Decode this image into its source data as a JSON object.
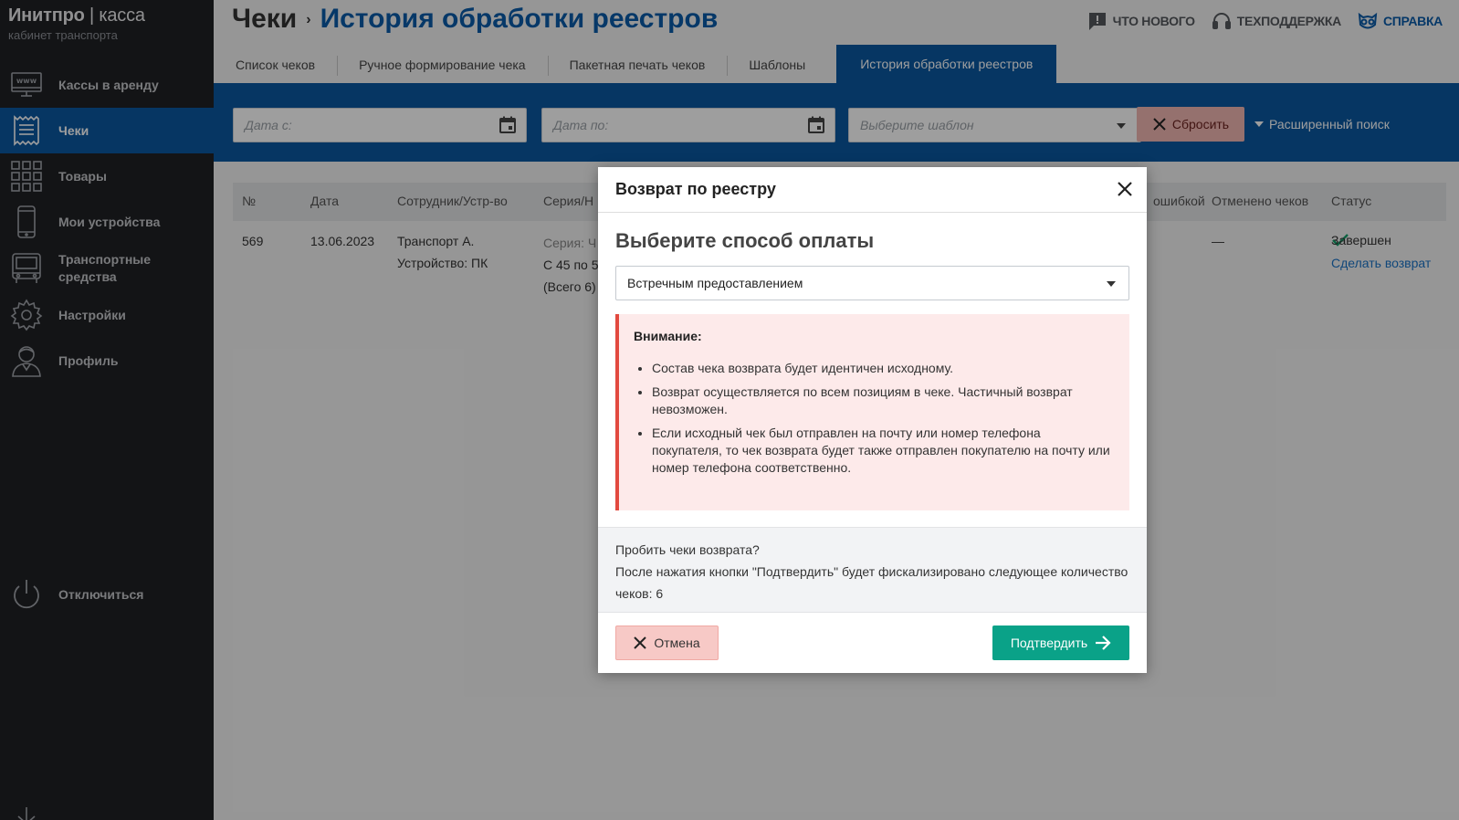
{
  "brand": {
    "name": "Инитпро",
    "separator": "|",
    "product": "касса",
    "subtitle": "кабинет транспорта"
  },
  "sidebar": {
    "items": [
      {
        "label": "Кассы в аренду",
        "icon": "www-icon"
      },
      {
        "label": "Чеки",
        "icon": "receipt-icon",
        "active": true
      },
      {
        "label": "Товары",
        "icon": "grid-icon"
      },
      {
        "label": "Мои устройства",
        "icon": "phone-icon"
      },
      {
        "label": "Транспортные средства",
        "icon": "bus-icon"
      },
      {
        "label": "Настройки",
        "icon": "gear-icon"
      },
      {
        "label": "Профиль",
        "icon": "user-icon"
      }
    ],
    "logout_label": "Отключиться"
  },
  "header": {
    "title_root": "Чеки",
    "title_sep": "›",
    "title_current": "История обработки реестров",
    "links": {
      "whats_new": "Что нового",
      "support": "Техподдержка",
      "help": "Справка"
    }
  },
  "tabs": [
    {
      "label": "Список чеков"
    },
    {
      "label": "Ручное формирование чека"
    },
    {
      "label": "Пакетная печать чеков"
    },
    {
      "label": "Шаблоны"
    },
    {
      "label": "История обработки реестров",
      "active": true
    }
  ],
  "filters": {
    "date_from_placeholder": "Дата с:",
    "date_to_placeholder": "Дата по:",
    "template_placeholder": "Выберите шаблон",
    "reset_label": "Сбросить",
    "advanced_label": "Расширенный поиск"
  },
  "table": {
    "headers": {
      "num": "№",
      "date": "Дата",
      "employee": "Сотрудник/Устр-во",
      "series": "Серия/Н",
      "errors": "ошибкой",
      "cancelled": "Отменено чеков",
      "status": "Статус"
    },
    "row": {
      "num": "569",
      "date": "13.06.2023",
      "employee": "Транспорт А.",
      "device": "Устройство: ПК",
      "series_label": "Серия: Ч",
      "series_range": "С 45 по 5",
      "series_total": "(Всего 6)",
      "cancelled": "—",
      "status": "Завершен",
      "action": "Сделать возврат"
    }
  },
  "modal": {
    "title": "Возврат по реестру",
    "subtitle": "Выберите способ оплаты",
    "payment_method": "Встречным предоставлением",
    "alert_title": "Внимание:",
    "alert_items": [
      "Состав чека возврата будет идентичен исходному.",
      "Возврат осуществляется по всем позициям в чеке. Частичный возврат невозможен.",
      "Если исходный чек был отправлен на почту или номер телефона покупателя, то чек возврата будет также отправлен покупателю на почту или номер телефона соответственно."
    ],
    "confirm_question": "Пробить чеки возврата?",
    "confirm_text": "После нажатия кнопки \"Подтвердить\" будет фискализировано следующее количество чеков: 6",
    "cancel_label": "Отмена",
    "confirm_label": "Подтвердить"
  },
  "colors": {
    "primary": "#0a57a0",
    "sidebar": "#202124",
    "accent_green": "#0aa288",
    "danger": "#e2493f"
  }
}
